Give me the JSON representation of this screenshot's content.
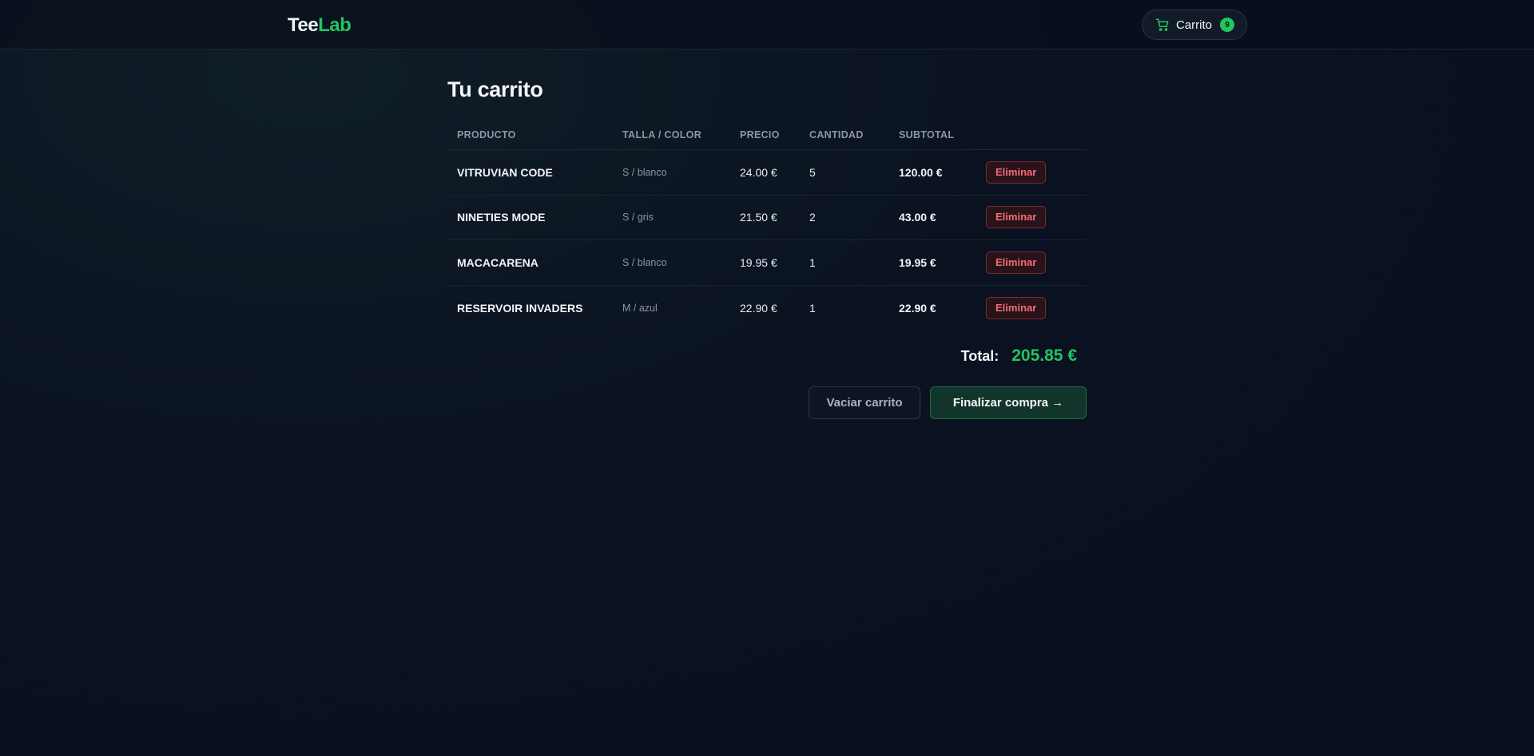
{
  "header": {
    "logo_part1": "Tee",
    "logo_part2": "Lab",
    "cart_label": "Carrito",
    "cart_count": "9"
  },
  "page": {
    "title": "Tu carrito"
  },
  "table": {
    "headers": [
      "PRODUCTO",
      "TALLA / COLOR",
      "PRECIO",
      "CANTIDAD",
      "SUBTOTAL"
    ],
    "rows": [
      {
        "product": "VITRUVIAN CODE",
        "variant": "S / blanco",
        "price": "24.00 €",
        "qty": "5",
        "subtotal": "120.00 €",
        "remove": "Eliminar"
      },
      {
        "product": "NINETIES MODE",
        "variant": "S / gris",
        "price": "21.50 €",
        "qty": "2",
        "subtotal": "43.00 €",
        "remove": "Eliminar"
      },
      {
        "product": "MACACARENA",
        "variant": "S / blanco",
        "price": "19.95 €",
        "qty": "1",
        "subtotal": "19.95 €",
        "remove": "Eliminar"
      },
      {
        "product": "RESERVOIR INVADERS",
        "variant": "M / azul",
        "price": "22.90 €",
        "qty": "1",
        "subtotal": "22.90 €",
        "remove": "Eliminar"
      }
    ]
  },
  "summary": {
    "total_label": "Total:",
    "total_value": "205.85 €"
  },
  "actions": {
    "empty_label": "Vaciar carrito",
    "checkout_label": "Finalizar compra →"
  },
  "colors": {
    "accent": "#22c55e",
    "danger": "#f26d74",
    "background": "#0a1120"
  }
}
